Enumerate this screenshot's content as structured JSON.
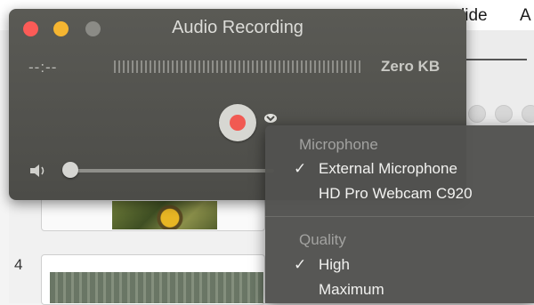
{
  "background_app": {
    "menubar": {
      "items": [
        "lide",
        "A"
      ]
    },
    "slide_number": "4"
  },
  "recorder": {
    "title": "Audio Recording",
    "timecode": "--:--",
    "file_size": "Zero KB",
    "volume_level": 0.0
  },
  "menu": {
    "sections": [
      {
        "heading": "Microphone",
        "items": [
          {
            "label": "External Microphone",
            "checked": "✓"
          },
          {
            "label": "HD Pro Webcam C920",
            "checked": ""
          }
        ]
      },
      {
        "heading": "Quality",
        "items": [
          {
            "label": "High",
            "checked": "✓"
          },
          {
            "label": "Maximum",
            "checked": ""
          }
        ]
      }
    ]
  },
  "icons": {
    "record": "record-icon",
    "options": "chevron-down-icon",
    "volume": "speaker-icon"
  },
  "colors": {
    "close": "#fc5b57",
    "minimize": "#f5b531",
    "record": "#f15a52"
  }
}
